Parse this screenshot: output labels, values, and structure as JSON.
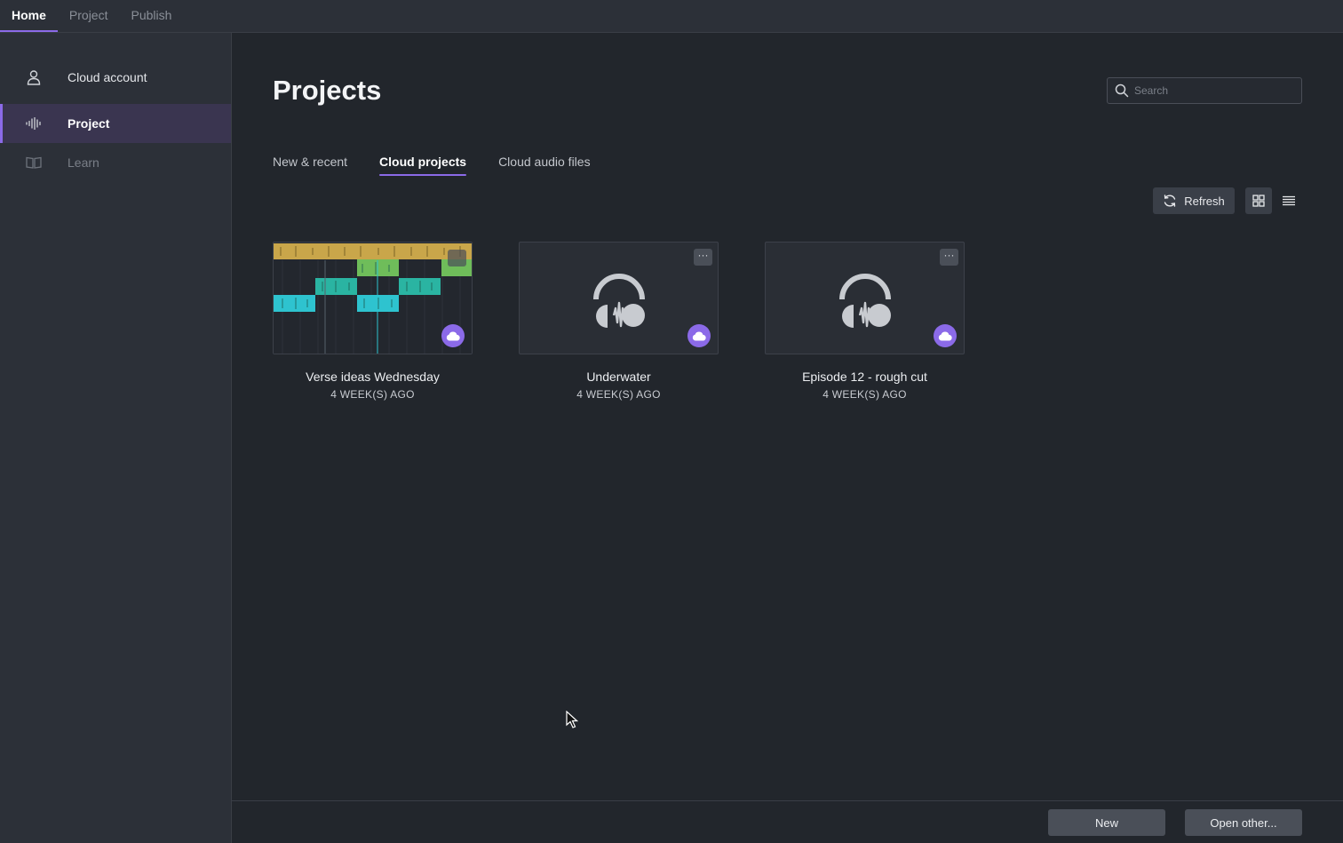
{
  "topbar": {
    "tabs": [
      {
        "label": "Home",
        "active": true
      },
      {
        "label": "Project",
        "active": false
      },
      {
        "label": "Publish",
        "active": false
      }
    ]
  },
  "sidebar": {
    "items": [
      {
        "label": "Cloud account",
        "icon": "user-icon"
      },
      {
        "label": "Project",
        "icon": "waveform-icon",
        "active": true
      },
      {
        "label": "Learn",
        "icon": "book-icon"
      }
    ]
  },
  "main": {
    "title": "Projects",
    "search": {
      "placeholder": "Search",
      "value": ""
    },
    "tabs": [
      {
        "label": "New & recent",
        "active": false
      },
      {
        "label": "Cloud projects",
        "active": true
      },
      {
        "label": "Cloud audio files",
        "active": false
      }
    ],
    "refresh_label": "Refresh",
    "projects": [
      {
        "name": "Verse ideas Wednesday",
        "date": "4 WEEK(S) AGO",
        "thumbnail": "waveform-preview"
      },
      {
        "name": "Underwater",
        "date": "4 WEEK(S) AGO",
        "thumbnail": "audacity-logo"
      },
      {
        "name": "Episode 12 - rough cut",
        "date": "4 WEEK(S) AGO",
        "thumbnail": "audacity-logo"
      }
    ],
    "more_label": "···"
  },
  "bottom": {
    "new_label": "New",
    "open_label": "Open other..."
  },
  "colors": {
    "accent": "#8b6ae8",
    "background": "#22262c",
    "panel": "#2c3038"
  }
}
